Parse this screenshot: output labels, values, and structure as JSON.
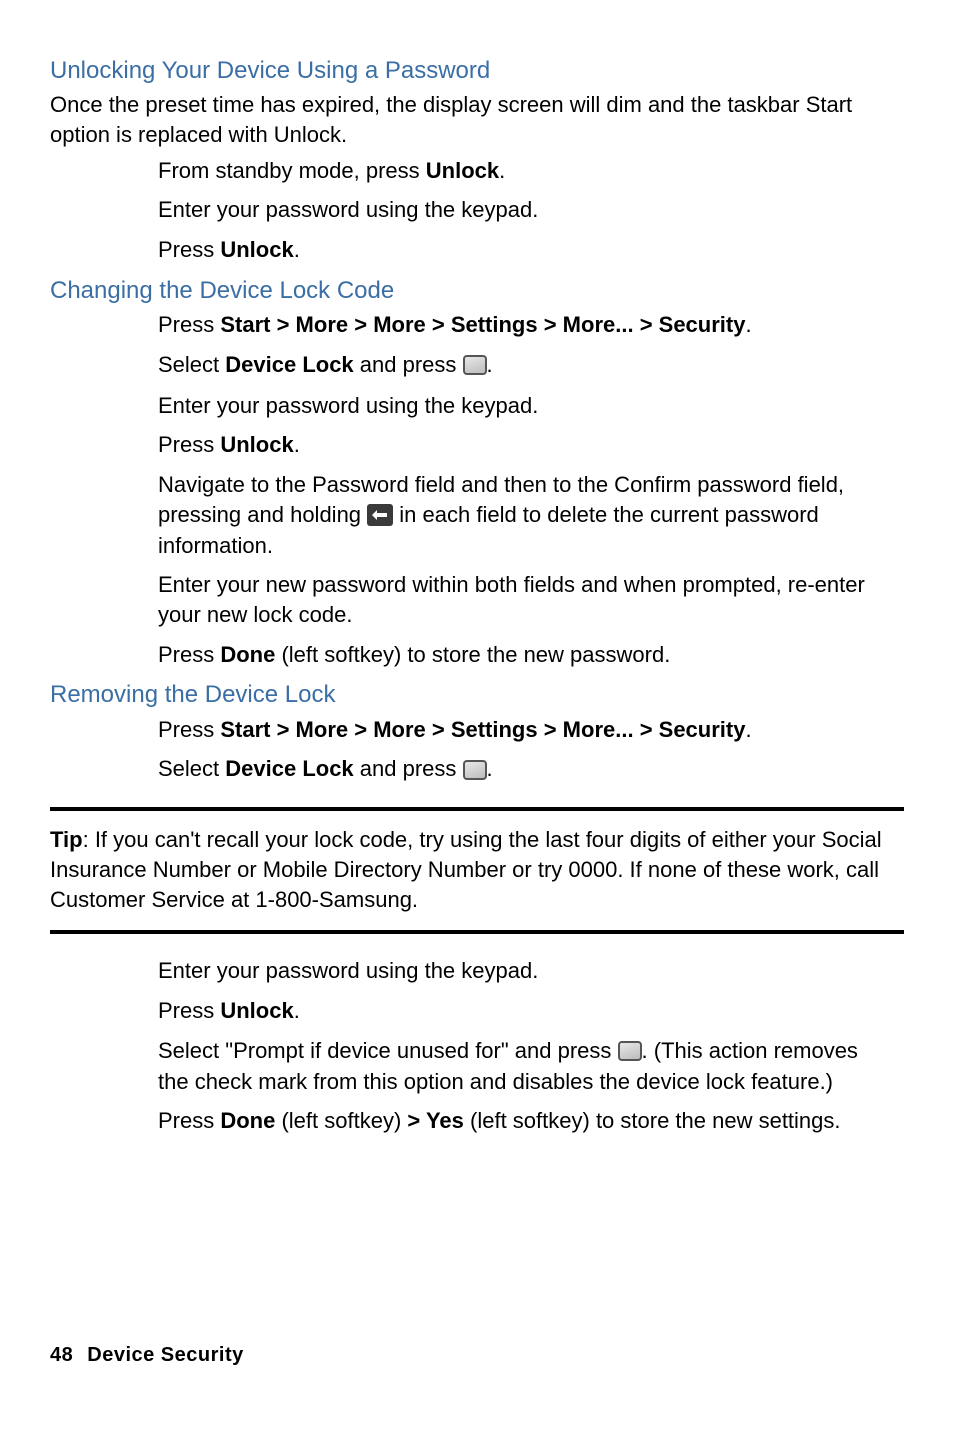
{
  "section1": {
    "heading": "Unlocking Your Device Using a Password",
    "intro": "Once the preset time has expired, the display screen will dim and the taskbar Start option is replaced with Unlock.",
    "step1_a": "From standby mode, press ",
    "step1_b": "Unlock",
    "step1_c": ".",
    "step2": "Enter your password using the keypad.",
    "step3_a": "Press ",
    "step3_b": "Unlock",
    "step3_c": "."
  },
  "section2": {
    "heading": "Changing the Device Lock Code",
    "step1_a": "Press ",
    "step1_b": "Start > More > More > Settings > More... > Security",
    "step1_c": ".",
    "step2_a": "Select ",
    "step2_b": "Device Lock",
    "step2_c": " and press ",
    "step2_d": ".",
    "step3": "Enter your password using the keypad.",
    "step4_a": "Press ",
    "step4_b": "Unlock",
    "step4_c": ".",
    "step5_a": "Navigate to the Password field and then to the Confirm password field, pressing and holding ",
    "step5_b": " in each field to delete the current password information.",
    "step6": "Enter your new password within both fields and when prompted, re-enter your new lock code.",
    "step7_a": "Press ",
    "step7_b": "Done",
    "step7_c": " (left softkey) to store the new password."
  },
  "section3": {
    "heading": "Removing the Device Lock",
    "step1_a": "Press ",
    "step1_b": "Start > More > More > Settings > More... > Security",
    "step1_c": ".",
    "step2_a": "Select ",
    "step2_b": "Device Lock",
    "step2_c": " and press ",
    "step2_d": "."
  },
  "tip": {
    "label": "Tip",
    "text": ": If you can't recall your lock code, try using the last four digits of either your Social Insurance Number or Mobile Directory Number or try 0000. If none of these work, call Customer Service at 1-800-Samsung."
  },
  "section4": {
    "step1": "Enter your password using the keypad.",
    "step2_a": "Press ",
    "step2_b": "Unlock",
    "step2_c": ".",
    "step3_a": "Select \"Prompt if device unused for\" and press ",
    "step3_b": ". (This action removes the check mark from this option and disables the device lock feature.)",
    "step4_a": "Press ",
    "step4_b": "Done",
    "step4_c": " (left softkey) ",
    "step4_d": "> Yes",
    "step4_e": " (left softkey) to store the new settings."
  },
  "footer": {
    "page": "48",
    "title": "Device Security"
  }
}
